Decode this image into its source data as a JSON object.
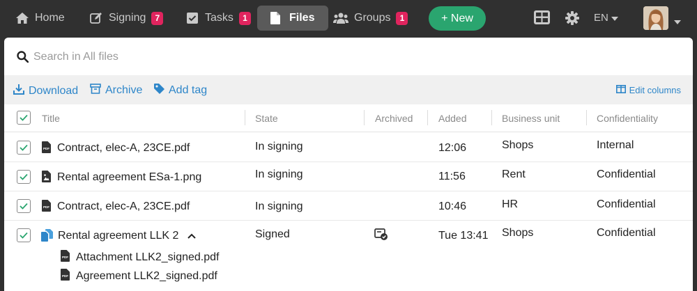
{
  "nav": {
    "home": "Home",
    "signing": "Signing",
    "signing_badge": "7",
    "tasks": "Tasks",
    "tasks_badge": "1",
    "files": "Files",
    "groups": "Groups",
    "groups_badge": "1",
    "new_button": "+ New",
    "language": "EN"
  },
  "search": {
    "placeholder": "Search in All files",
    "value": ""
  },
  "actions": {
    "download": "Download",
    "archive": "Archive",
    "add_tag": "Add tag",
    "edit_columns": "Edit columns"
  },
  "table": {
    "columns": [
      "Title",
      "State",
      "Archived",
      "Added",
      "Business unit",
      "Confidentiality"
    ],
    "rows": [
      {
        "title": "Contract, elec-A, 23CE.pdf",
        "state": "In signing",
        "added": "12:06",
        "unit": "Shops",
        "conf": "Internal"
      },
      {
        "title": "Rental agreement ESa-1.png",
        "state": "In signing",
        "added": "11:56",
        "unit": "Rent",
        "conf": "Confidential"
      },
      {
        "title": "Contract, elec-A, 23CE.pdf",
        "state": "In signing",
        "added": "10:46",
        "unit": "HR",
        "conf": "Confidential"
      },
      {
        "title": "Rental agreement LLK 2",
        "state": "Signed",
        "added": "Tue 13:41",
        "unit": "Shops",
        "conf": "Confidential",
        "children": [
          "Attachment LLK2_signed.pdf",
          "Agreement LLK2_signed.pdf"
        ]
      }
    ]
  },
  "colors": {
    "accent": "#2aa56f",
    "link": "#2e86c9",
    "badge": "#e0245e",
    "topbar": "#303030"
  }
}
